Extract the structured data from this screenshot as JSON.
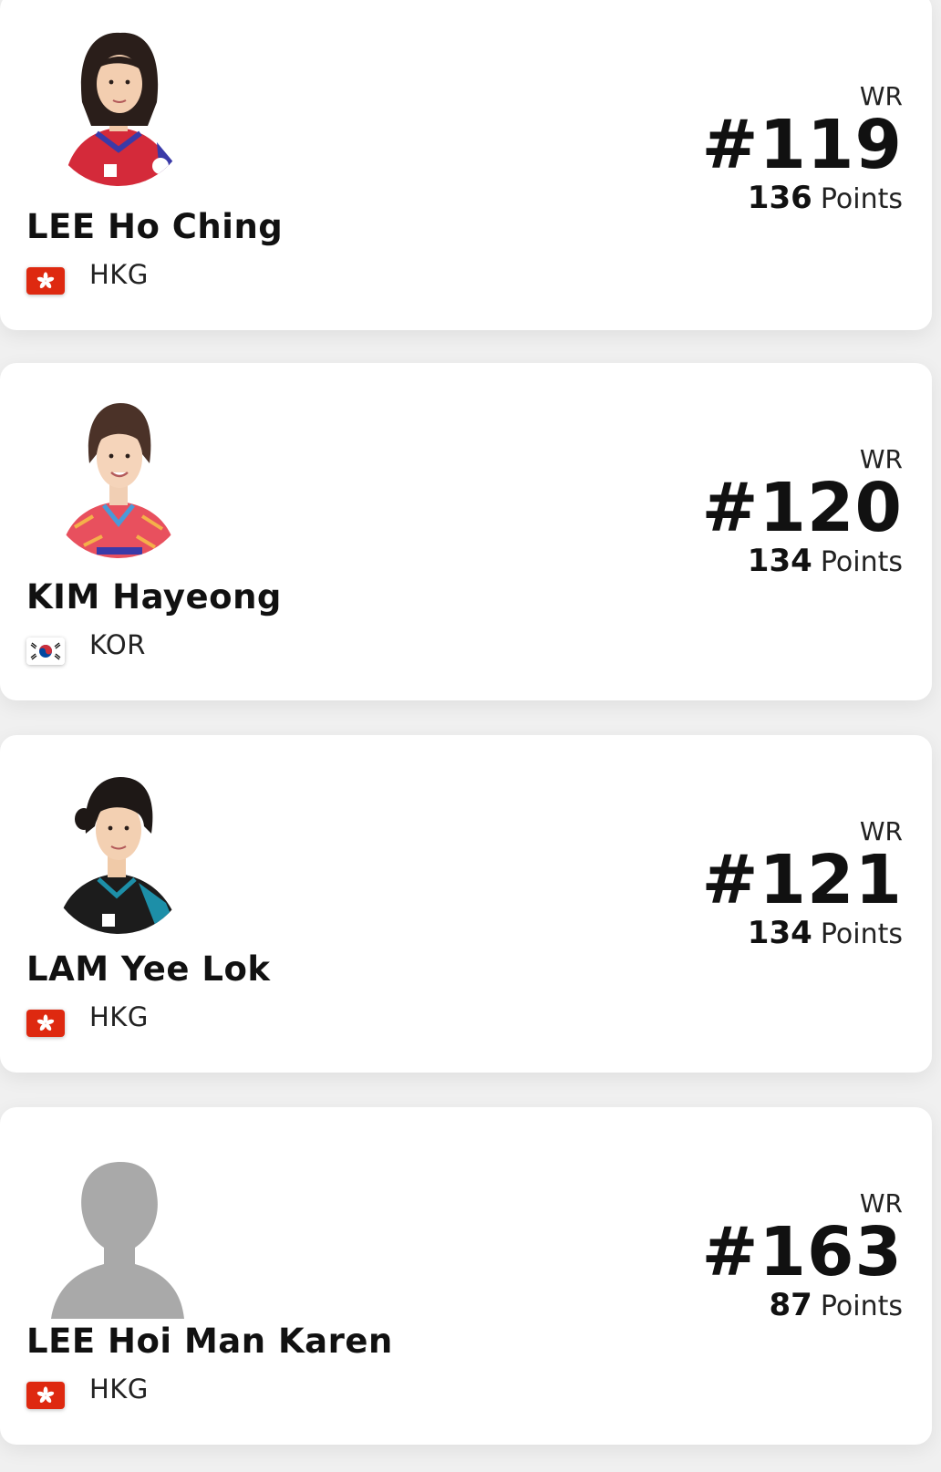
{
  "players": [
    {
      "name": "LEE Ho Ching",
      "country": "HKG",
      "flag_icon": "hong-kong-flag-icon",
      "rank_label": "WR",
      "rank": "#119",
      "points": "136",
      "points_label": "Points",
      "photo_icon": "player-photo",
      "jersey_color": "#d42a3a"
    },
    {
      "name": "KIM Hayeong",
      "country": "KOR",
      "flag_icon": "south-korea-flag-icon",
      "rank_label": "WR",
      "rank": "#120",
      "points": "134",
      "points_label": "Points",
      "photo_icon": "player-photo",
      "jersey_color": "#e8505e"
    },
    {
      "name": "LAM Yee Lok",
      "country": "HKG",
      "flag_icon": "hong-kong-flag-icon",
      "rank_label": "WR",
      "rank": "#121",
      "points": "134",
      "points_label": "Points",
      "photo_icon": "player-photo",
      "jersey_color": "#1c1c1c"
    },
    {
      "name": "LEE Hoi Man Karen",
      "country": "HKG",
      "flag_icon": "hong-kong-flag-icon",
      "rank_label": "WR",
      "rank": "#163",
      "points": "87",
      "points_label": "Points",
      "photo_icon": "avatar-placeholder-icon",
      "jersey_color": "#a9a9a9"
    }
  ],
  "colors": {
    "background": "#f0f0f0",
    "card": "#ffffff",
    "hong_kong_red": "#de2910",
    "korea_red": "#cd2e3a",
    "korea_blue": "#0047a0"
  }
}
